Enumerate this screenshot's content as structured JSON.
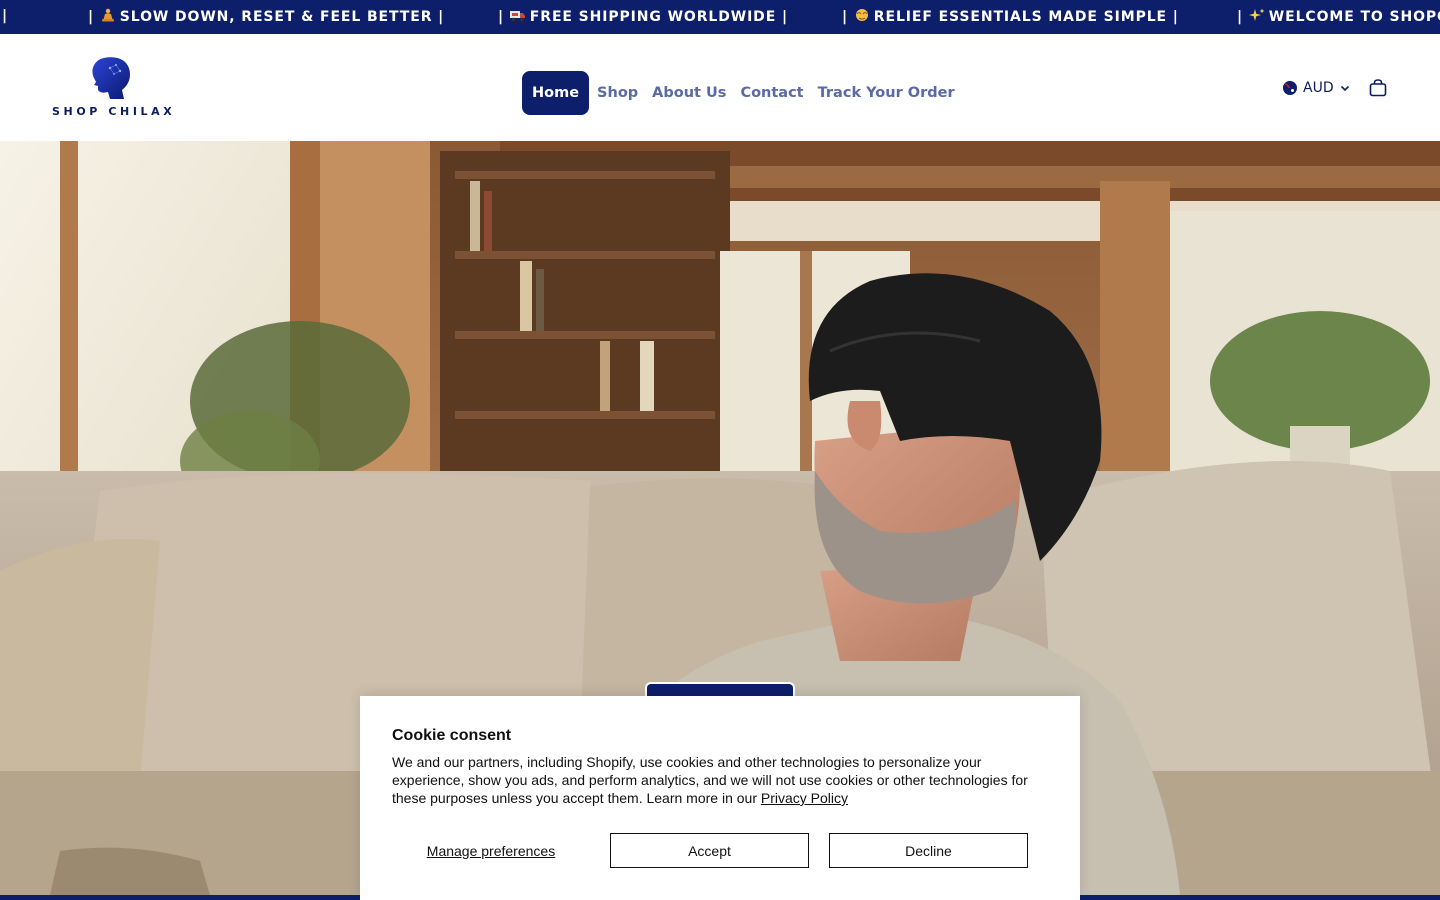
{
  "announcement": {
    "items": [
      {
        "prefix": "|",
        "text": ""
      },
      {
        "emoji_icon": "meditation-icon",
        "text": "SLOW DOWN, RESET & FEEL BETTER |",
        "prefix": "|"
      },
      {
        "emoji_icon": "truck-icon",
        "text": "FREE SHIPPING WORLDWIDE |",
        "prefix": "|"
      },
      {
        "emoji_icon": "relief-icon",
        "text": "RELIEF ESSENTIALS MADE SIMPLE |",
        "prefix": "|"
      },
      {
        "emoji_icon": "sparkles-icon",
        "text": "WELCOME TO SHOPCH",
        "prefix": "|"
      }
    ]
  },
  "header": {
    "logo_text": "SHOP CHILAX",
    "nav": [
      {
        "label": "Home",
        "active": true
      },
      {
        "label": "Shop",
        "active": false
      },
      {
        "label": "About Us",
        "active": false
      },
      {
        "label": "Contact",
        "active": false
      },
      {
        "label": "Track Your Order",
        "active": false
      }
    ],
    "currency": "AUD"
  },
  "cookie": {
    "title": "Cookie consent",
    "body": "We and our partners, including Shopify, use cookies and other technologies to personalize your experience, show you ads, and perform analytics, and we will not use cookies or other technologies for these purposes unless you accept them. Learn more in our ",
    "policy_link": "Privacy Policy",
    "manage_label": "Manage preferences",
    "accept_label": "Accept",
    "decline_label": "Decline"
  },
  "colors": {
    "brand_navy": "#0d1f6b",
    "nav_text": "#5a6aa6",
    "announcement_bg": "#0d1f6b"
  }
}
